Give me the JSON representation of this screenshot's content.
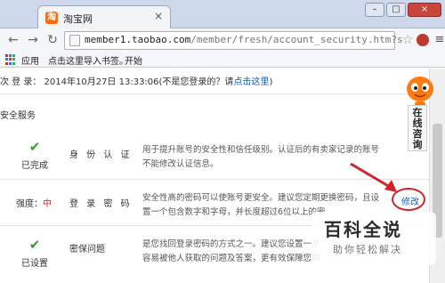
{
  "browser": {
    "tab_title": "淘宝网",
    "tab_favicon": "淘",
    "url_host": "member1.taobao.com",
    "url_path": "/member/fresh/account_security.htm?s",
    "bookmarks": {
      "apps_label": "应用",
      "import_label": "点击这里导入书签。",
      "start_label": "开始"
    }
  },
  "page": {
    "last_login_prefix": "次 登 录： 2014年10月27日 13:33:06(不是您登录的？请",
    "last_login_link": "点击这里",
    "last_login_suffix": ")",
    "section_title": "安全服务",
    "items": [
      {
        "status": "已完成",
        "name": "身 份 认 证",
        "desc": "用于提升账号的安全性和信任级别。认证后的有卖家记录的账号不能修改认证信息。"
      },
      {
        "strength_label": "强度：",
        "strength_value": "中",
        "name": "登 录 密 码",
        "desc": "安全性高的密码可以使账号更安全。建议您定期更换密码，且设置一个包含数字和字母，并长度超过6位以上的密",
        "action": "修改"
      },
      {
        "status": "已设置",
        "name": "密保问题",
        "desc": "是您找回登录密码的方式之一。建议您设置一个容易被他人获取的问题及答案，更有效保障您的"
      }
    ]
  },
  "widgets": {
    "consult_label": "在线咨询"
  },
  "watermark": {
    "logo": "百科全说",
    "tagline": "助你轻松解决"
  },
  "colors": {
    "accent_link": "#1a5ab8",
    "danger": "#d22222",
    "success": "#3a9b2f",
    "taobao_orange": "#ff6a00"
  },
  "icons": [
    "back-icon",
    "forward-icon",
    "reload-icon",
    "page-icon",
    "star-icon",
    "menu-icon",
    "check-icon",
    "arrow-icon"
  ]
}
